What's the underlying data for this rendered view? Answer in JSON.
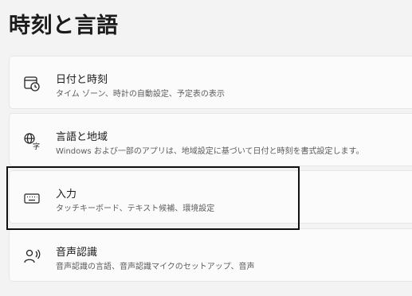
{
  "page": {
    "title": "時刻と言語"
  },
  "items": [
    {
      "title": "日付と時刻",
      "description": "タイム ゾーン、時計の自動設定、予定表の表示",
      "icon": "clock-calendar-icon"
    },
    {
      "title": "言語と地域",
      "description": "Windows および一部のアプリは、地域設定に基づいて日付と時刻を書式設定します。",
      "icon": "language-icon"
    },
    {
      "title": "入力",
      "description": "タッチキーボード、テキスト候補、環境設定",
      "icon": "keyboard-icon"
    },
    {
      "title": "音声認識",
      "description": "音声認識の言語、音声認識マイクのセットアップ、音声",
      "icon": "speech-icon"
    }
  ],
  "colors": {
    "card": "#fbfbfb",
    "background": "#f3f3f3",
    "highlight": "#111111"
  }
}
